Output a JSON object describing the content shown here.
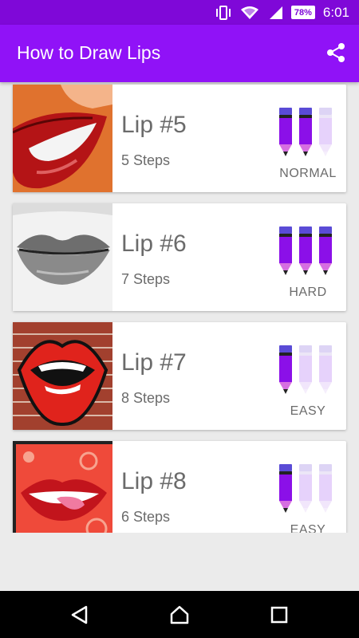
{
  "status_bar": {
    "battery_percent": "78%",
    "time": "6:01",
    "icons": [
      "vibrate-icon",
      "wifi-icon",
      "signal-icon",
      "battery-icon"
    ]
  },
  "app_bar": {
    "title": "How to Draw Lips",
    "share_icon": "share-icon"
  },
  "lessons": [
    {
      "title": "Lip #5",
      "steps": "5 Steps",
      "difficulty": "NORMAL",
      "level": 2,
      "max_level": 3
    },
    {
      "title": "Lip #6",
      "steps": "7 Steps",
      "difficulty": "HARD",
      "level": 3,
      "max_level": 3
    },
    {
      "title": "Lip #7",
      "steps": "8 Steps",
      "difficulty": "EASY",
      "level": 1,
      "max_level": 3
    },
    {
      "title": "Lip #8",
      "steps": "6 Steps",
      "difficulty": "EASY",
      "level": 1,
      "max_level": 3
    }
  ],
  "colors": {
    "status_bar": "#7f08d8",
    "app_bar": "#9012f7",
    "pencil_active": "#8b10e8",
    "pencil_inactive": "#e6d2fb",
    "background": "#ebebeb"
  },
  "nav_bar": {
    "back_icon": "back-icon",
    "home_icon": "home-icon",
    "recents_icon": "recents-icon"
  }
}
